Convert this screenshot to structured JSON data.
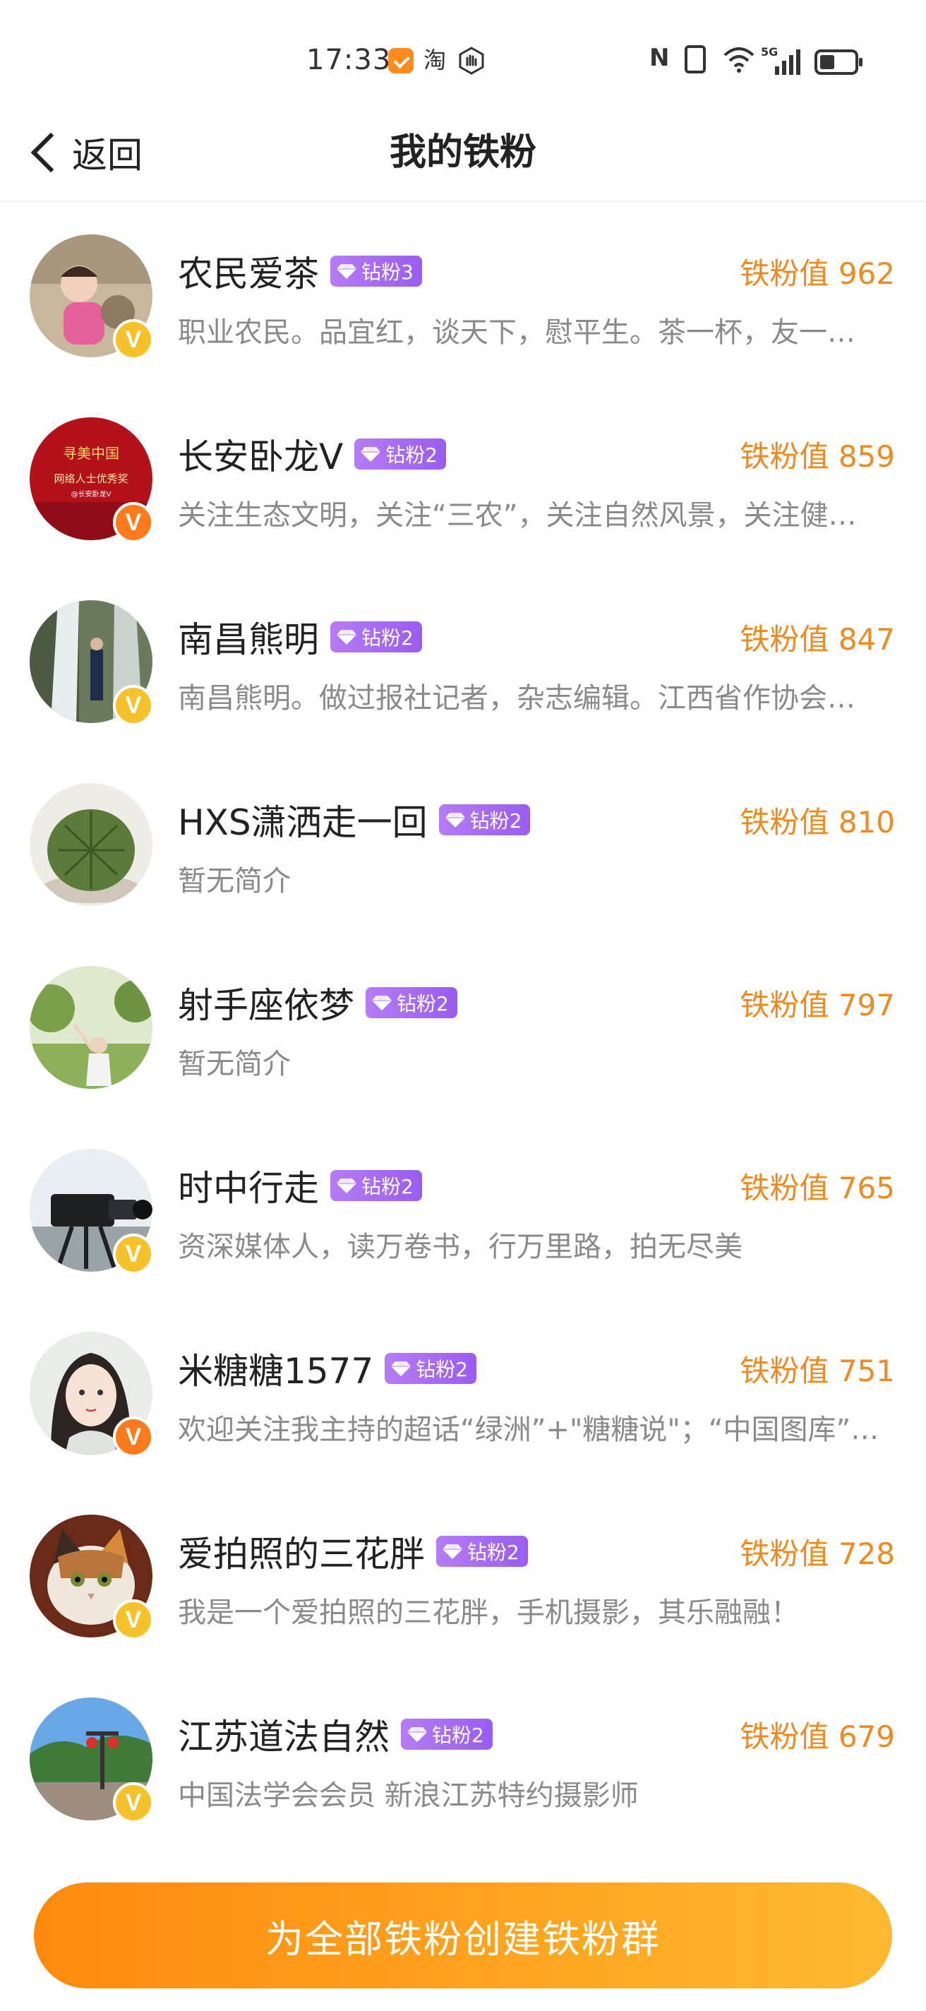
{
  "status_bar": {
    "time": "17:33",
    "icons": [
      "weibo-notify-icon",
      "taobao-icon",
      "hand-icon",
      "nfc-icon",
      "vibrate-icon",
      "wifi-icon",
      "5g-signal-icon",
      "battery-icon"
    ],
    "taobao_glyph": "淘",
    "nfc_glyph": "N",
    "network": "5G"
  },
  "header": {
    "back_label": "返回",
    "title": "我的铁粉"
  },
  "colors": {
    "accent_orange": "#f0891e",
    "badge_purple": "#a469f2",
    "verify_gold": "#f5c22b",
    "verify_orange": "#ff7a1a"
  },
  "fans": [
    {
      "name": "农民爱茶",
      "badge": "钻粉3",
      "score": "铁粉值 962",
      "bio": "职业农民。品宜红，谈天下，慰平生。茶一杯，友一…",
      "verify": "gold",
      "avatar": "child-photo"
    },
    {
      "name": "长安卧龙V",
      "badge": "钻粉2",
      "score": "铁粉值 859",
      "bio": "关注生态文明，关注“三农”，关注自然风景，关注健…",
      "verify": "orange",
      "avatar": "award-red"
    },
    {
      "name": "南昌熊明",
      "badge": "钻粉2",
      "score": "铁粉值 847",
      "bio": "南昌熊明。做过报社记者，杂志编辑。江西省作协会…",
      "verify": "gold",
      "avatar": "waterfall"
    },
    {
      "name": "HXS潇洒走一回",
      "badge": "钻粉2",
      "score": "铁粉值 810",
      "bio": "暂无简介",
      "verify": "",
      "avatar": "cactus"
    },
    {
      "name": "射手座依梦",
      "badge": "钻粉2",
      "score": "铁粉值 797",
      "bio": "暂无简介",
      "verify": "",
      "avatar": "park"
    },
    {
      "name": "时中行走",
      "badge": "钻粉2",
      "score": "铁粉值 765",
      "bio": "资深媒体人，读万卷书，行万里路，拍无尽美",
      "verify": "gold",
      "avatar": "camera"
    },
    {
      "name": "米糖糖1577",
      "badge": "钻粉2",
      "score": "铁粉值 751",
      "bio": "欢迎关注我主持的超话“绿洲”+\"糖糖说\"；“中国图库”…",
      "verify": "orange",
      "avatar": "portrait"
    },
    {
      "name": "爱拍照的三花胖",
      "badge": "钻粉2",
      "score": "铁粉值 728",
      "bio": "我是一个爱拍照的三花胖，手机摄影，其乐融融！",
      "verify": "gold",
      "avatar": "cat"
    },
    {
      "name": "江苏道法自然",
      "badge": "钻粉2",
      "score": "铁粉值 679",
      "bio": "中国法学会会员 新浪江苏特约摄影师",
      "verify": "gold",
      "avatar": "landscape"
    }
  ],
  "avatar_text": {
    "award_line1": "寻美中国",
    "award_line2": "网络人士优秀奖",
    "award_line3": "@长安卧龙V"
  },
  "verify_glyph": "V",
  "cta_label": "为全部铁粉创建铁粉群"
}
